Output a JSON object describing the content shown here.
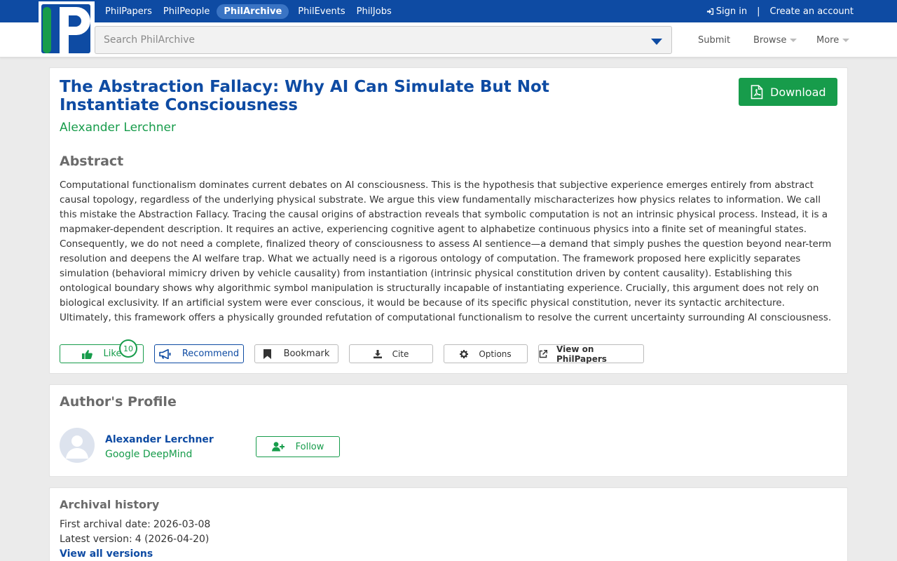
{
  "topnav": {
    "items": [
      "PhilPapers",
      "PhilPeople",
      "PhilArchive",
      "PhilEvents",
      "PhilJobs"
    ],
    "active_index": 2,
    "sign_in": "Sign in",
    "separator": "|",
    "create_account": "Create an account"
  },
  "search": {
    "placeholder": "Search PhilArchive",
    "value": ""
  },
  "menu": {
    "submit": "Submit",
    "browse": "Browse",
    "more": "More"
  },
  "paper": {
    "title": "The Abstraction Fallacy: Why AI Can Simulate But Not Instantiate Consciousness",
    "author": "Alexander Lerchner",
    "download_label": "Download",
    "abstract_heading": "Abstract",
    "abstract": "Computational functionalism dominates current debates on AI consciousness. This is the hypothesis that subjective experience emerges entirely from abstract causal topology, regardless of the underlying physical substrate. We argue this view fundamentally mischaracterizes how physics relates to information. We call this mistake the Abstraction Fallacy. Tracing the causal origins of abstraction reveals that symbolic computation is not an intrinsic physical process. Instead, it is a mapmaker-dependent description. It requires an active, experiencing cognitive agent to alphabetize continuous physics into a finite set of meaningful states. Consequently, we do not need a complete, finalized theory of consciousness to assess AI sentience—a demand that simply pushes the question beyond near-term resolution and deepens the AI welfare trap. What we actually need is a rigorous ontology of computation. The framework proposed here explicitly separates simulation (behavioral mimicry driven by vehicle causality) from instantiation (intrinsic physical constitution driven by content causality). Establishing this ontological boundary shows why algorithmic symbol manipulation is structurally incapable of instantiating experience. Crucially, this argument does not rely on biological exclusivity. If an artificial system were ever conscious, it would be because of its specific physical constitution, never its syntactic architecture. Ultimately, this framework offers a physically grounded refutation of computational functionalism to resolve the current uncertainty surrounding AI consciousness."
  },
  "actions": {
    "like": "Like",
    "like_count": "10",
    "recommend": "Recommend",
    "bookmark": "Bookmark",
    "cite": "Cite",
    "options": "Options",
    "view_philpapers": "View on PhilPapers"
  },
  "profile": {
    "heading": "Author's Profile",
    "name": "Alexander Lerchner",
    "affiliation": "Google DeepMind",
    "follow": "Follow"
  },
  "archive": {
    "heading": "Archival history",
    "first_label": "First archival date:",
    "first_date": "2026-03-08",
    "latest_label": "Latest version:",
    "latest_value": "4 (2026-04-20)",
    "view_all": "View all versions"
  },
  "colors": {
    "brand_blue": "#0e4ba3",
    "brand_green": "#179c4b",
    "background": "#ebebeb"
  },
  "icons": [
    "sign-in-icon",
    "dropdown-caret-icon",
    "pdf-icon",
    "thumbs-up-icon",
    "megaphone-icon",
    "bookmark-icon",
    "download-icon",
    "gear-icon",
    "external-link-icon",
    "user-plus-icon"
  ]
}
